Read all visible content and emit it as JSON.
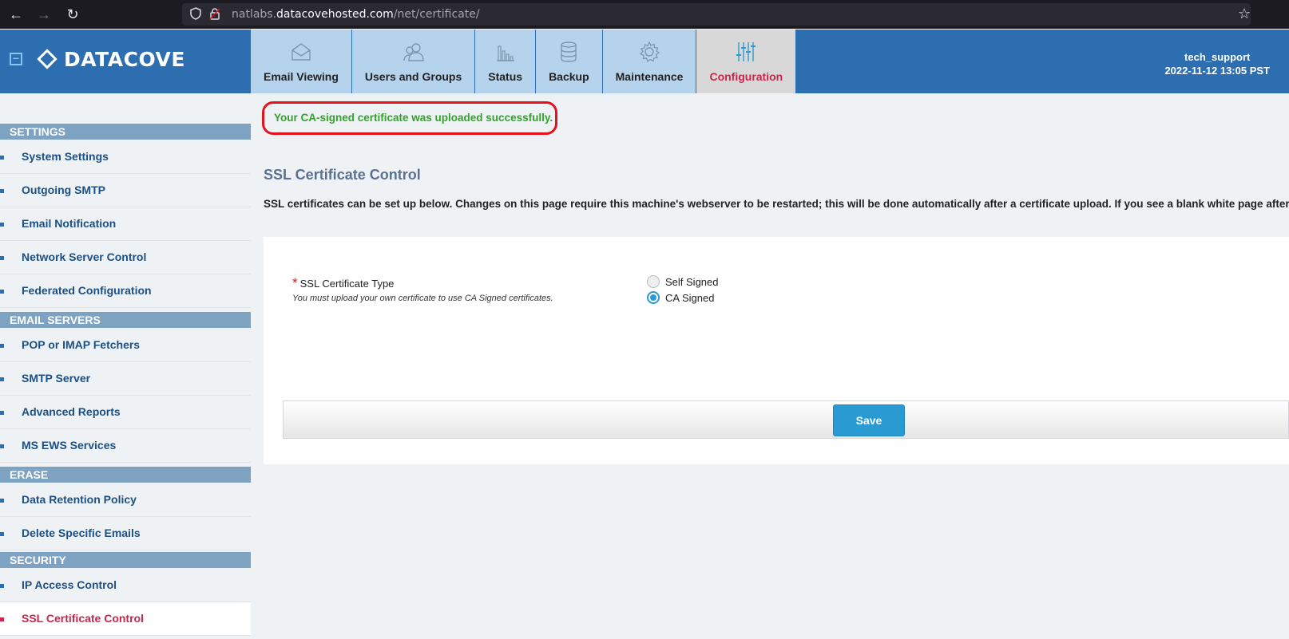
{
  "browser": {
    "url_prefix": "natlabs.",
    "url_host": "datacovehosted.com",
    "url_path": "/net/certificate/"
  },
  "app": {
    "logo_text": "DATACOVE",
    "tabs": [
      {
        "label": "Email Viewing",
        "icon": "envelope-icon"
      },
      {
        "label": "Users and Groups",
        "icon": "users-icon"
      },
      {
        "label": "Status",
        "icon": "bar-chart-icon"
      },
      {
        "label": "Backup",
        "icon": "database-icon"
      },
      {
        "label": "Maintenance",
        "icon": "gear-icon"
      },
      {
        "label": "Configuration",
        "icon": "sliders-icon",
        "active": true
      }
    ],
    "user": {
      "name": "tech_support",
      "datetime": "2022-11-12 13:05 PST"
    }
  },
  "sidebar": {
    "sections": [
      {
        "title": "SETTINGS",
        "items": [
          "System Settings",
          "Outgoing SMTP",
          "Email Notification",
          "Network Server Control",
          "Federated Configuration"
        ]
      },
      {
        "title": "EMAIL SERVERS",
        "items": [
          "POP or IMAP Fetchers",
          "SMTP Server",
          "Advanced Reports",
          "MS EWS Services"
        ]
      },
      {
        "title": "ERASE",
        "items": [
          "Data Retention Policy",
          "Delete Specific Emails"
        ]
      },
      {
        "title": "SECURITY",
        "items": [
          "IP Access Control",
          "SSL Certificate Control"
        ]
      }
    ],
    "active_item": "SSL Certificate Control"
  },
  "main": {
    "flash_message": "Your CA-signed certificate was uploaded successfully.",
    "title": "SSL Certificate Control",
    "description": "SSL certificates can be set up below. Changes on this page require this machine's webserver to be restarted; this will be done automatically after a certificate upload. If you see a blank white page after saving",
    "field": {
      "required_mark": "*",
      "label": "SSL Certificate Type",
      "help": "You must upload your own certificate to use CA Signed certificates.",
      "options": [
        {
          "label": "Self Signed",
          "checked": false
        },
        {
          "label": "CA Signed",
          "checked": true
        }
      ]
    },
    "save_label": "Save"
  },
  "colors": {
    "header_blue": "#2c6eb0",
    "tab_bg": "#b6d3ee",
    "active_red": "#c8264a",
    "success_green": "#33a12c",
    "button_blue": "#2a9bd2"
  }
}
